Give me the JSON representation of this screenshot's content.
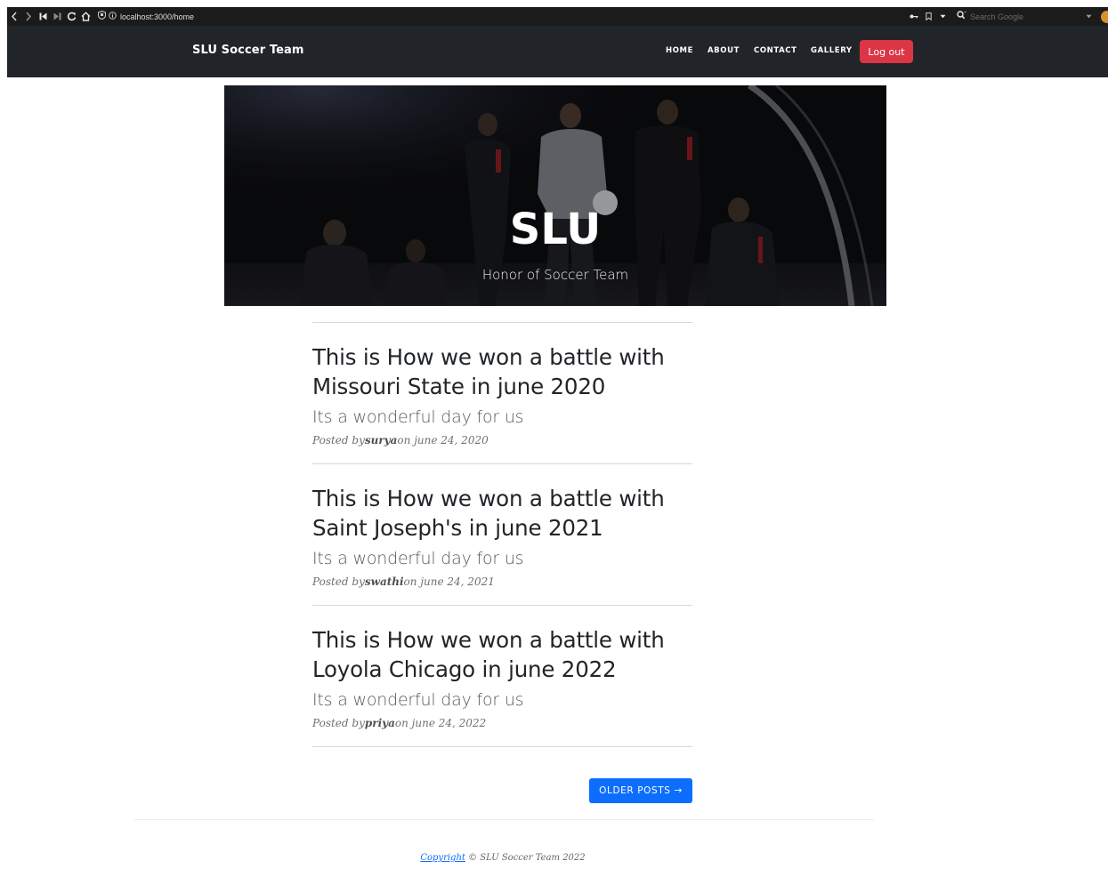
{
  "browser": {
    "url": "localhost:3000/home",
    "search_placeholder": "Search Google"
  },
  "navbar": {
    "brand": "SLU Soccer Team",
    "links": [
      "HOME",
      "ABOUT",
      "CONTACT",
      "GALLERY"
    ],
    "logout_label": "Log out"
  },
  "hero": {
    "title": "SLU",
    "subtitle": "Honor of Soccer Team"
  },
  "posts": [
    {
      "title": "This is How we won a battle with Missouri State in june 2020",
      "subtitle": "Its a wonderful day for us",
      "meta_prefix": "Posted by",
      "author": "surya",
      "meta_suffix": "on june 24, 2020"
    },
    {
      "title": "This is How we won a battle with Saint Joseph's in june 2021",
      "subtitle": "Its a wonderful day for us",
      "meta_prefix": "Posted by",
      "author": "swathi",
      "meta_suffix": "on june 24, 2021"
    },
    {
      "title": "This is How we won a battle with Loyola Chicago in june 2022",
      "subtitle": "Its a wonderful day for us",
      "meta_prefix": "Posted by",
      "author": "priya",
      "meta_suffix": "on june 24, 2022"
    }
  ],
  "pager": {
    "older_label": "OLDER POSTS →"
  },
  "footer": {
    "link": "Copyright",
    "text": " © SLU Soccer Team 2022"
  },
  "colors": {
    "navbar_bg": "#212529",
    "logout_bg": "#dc3545",
    "primary_button": "#0d6efd"
  },
  "icons": [
    "back-icon",
    "forward-icon",
    "first-icon",
    "last-icon",
    "reload-icon",
    "home-icon",
    "shield-icon",
    "info-icon",
    "key-icon",
    "bookmark-icon",
    "dropdown-icon",
    "search-icon"
  ]
}
